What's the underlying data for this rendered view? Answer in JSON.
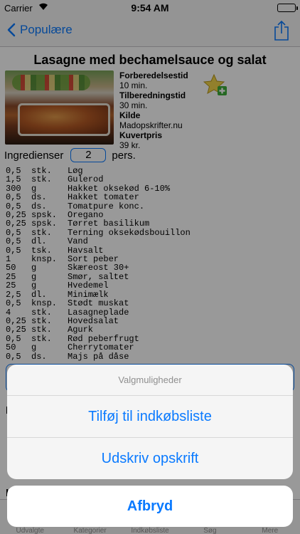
{
  "status_bar": {
    "carrier": "Carrier",
    "time": "9:54 AM"
  },
  "nav": {
    "back_label": "Populære"
  },
  "recipe": {
    "title": "Lasagne med bechamelsauce og salat",
    "prep_label": "Forberedelsestid",
    "prep_value": "10 min.",
    "cook_label": "Tilberedningstid",
    "cook_value": "30 min.",
    "source_label": "Kilde",
    "source_value": "Madopskrifter.nu",
    "price_label": "Kuvertpris",
    "price_value": "39 kr."
  },
  "ingredients": {
    "heading": "Ingredienser",
    "persons": "2",
    "persons_unit": "pers.",
    "items": [
      {
        "qty": "0,5",
        "unit": "stk.",
        "name": "Løg"
      },
      {
        "qty": "1,5",
        "unit": "stk.",
        "name": "Gulerod"
      },
      {
        "qty": "300",
        "unit": "g",
        "name": "Hakket oksekød 6-10%"
      },
      {
        "qty": "0,5",
        "unit": "ds.",
        "name": "Hakket tomater"
      },
      {
        "qty": "0,5",
        "unit": "ds.",
        "name": "Tomatpure konc."
      },
      {
        "qty": "0,25",
        "unit": "spsk.",
        "name": "Oregano"
      },
      {
        "qty": "0,25",
        "unit": "spsk.",
        "name": "Tørret basilikum"
      },
      {
        "qty": "0,5",
        "unit": "stk.",
        "name": "Terning oksekødsbouillon"
      },
      {
        "qty": "0,5",
        "unit": "dl.",
        "name": "Vand"
      },
      {
        "qty": "0,5",
        "unit": "tsk.",
        "name": "Havsalt"
      },
      {
        "qty": "1",
        "unit": "knsp.",
        "name": "Sort peber"
      },
      {
        "qty": "50",
        "unit": "g",
        "name": "Skæreost 30+"
      },
      {
        "qty": "25",
        "unit": "g",
        "name": "Smør, saltet"
      },
      {
        "qty": "25",
        "unit": "g",
        "name": "Hvedemel"
      },
      {
        "qty": "2,5",
        "unit": "dl.",
        "name": "Minimælk"
      },
      {
        "qty": "0,5",
        "unit": "knsp.",
        "name": "Stødt muskat"
      },
      {
        "qty": "4",
        "unit": "stk.",
        "name": "Lasagneplade"
      },
      {
        "qty": "0,25",
        "unit": "stk.",
        "name": "Hovedsalat"
      },
      {
        "qty": "0,25",
        "unit": "stk.",
        "name": "Agurk"
      },
      {
        "qty": "0,5",
        "unit": "stk.",
        "name": "Rød peberfrugt"
      },
      {
        "qty": "50",
        "unit": "g",
        "name": "Cherrytomater"
      },
      {
        "qty": "0,5",
        "unit": "ds.",
        "name": "Majs på dåse"
      }
    ]
  },
  "tabs": [
    "Udvalgte",
    "Kategorier",
    "Indkøbsliste",
    "Søg",
    "Mere"
  ],
  "action_sheet": {
    "title": "Valgmuligheder",
    "add_to_list": "Tilføj til indkøbsliste",
    "print": "Udskriv opskrift",
    "cancel": "Afbryd"
  },
  "colors": {
    "accent": "#0a7aff",
    "dim": "rgba(0,0,0,0.4)"
  },
  "icons": [
    "back-chevron-icon",
    "share-icon",
    "favorite-star-add-icon",
    "wifi-icon",
    "battery-icon"
  ]
}
